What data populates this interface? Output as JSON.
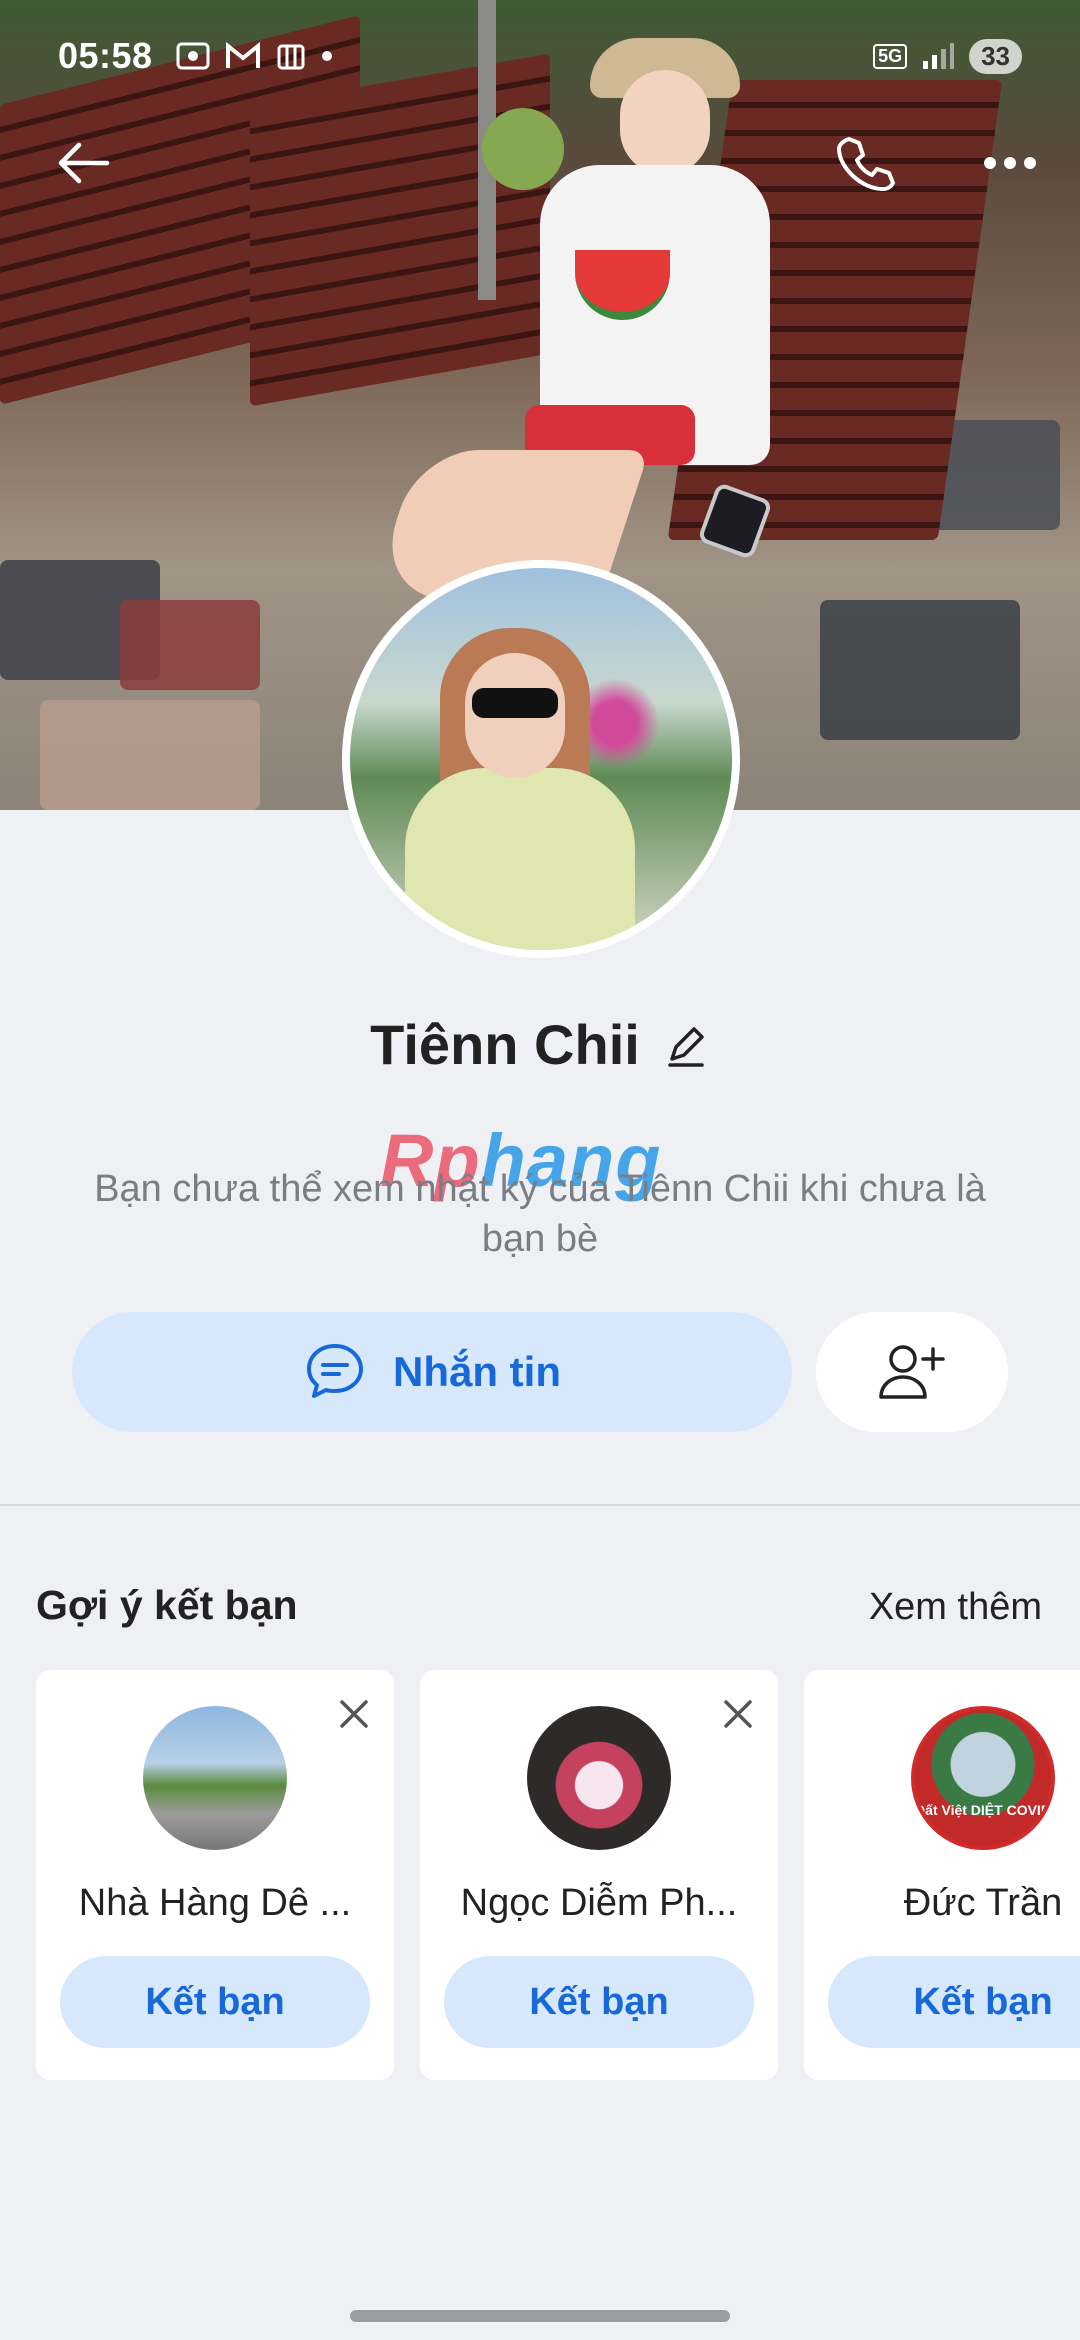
{
  "status_bar": {
    "time": "05:58",
    "network": "5G",
    "battery": "33"
  },
  "profile": {
    "name": "Tiênn Chii",
    "notice": "Bạn chưa thể xem nhật ký của Tiênn Chii khi chưa là bạn bè",
    "watermark_part1": "Rp",
    "watermark_part2": "hang"
  },
  "actions": {
    "message_label": "Nhắn tin"
  },
  "suggestions": {
    "title": "Gợi ý kết bạn",
    "see_more": "Xem thêm",
    "items": [
      {
        "name": "Nhà Hàng Dê ...",
        "button": "Kết bạn"
      },
      {
        "name": "Ngọc Diễm Ph...",
        "button": "Kết bạn"
      },
      {
        "name": "Đức Trần",
        "button": "Kết bạn",
        "avatar_text": "Đất Việt DIỆT COVID"
      }
    ]
  },
  "colors": {
    "accent": "#1769d9",
    "accent_light": "#d7e8fd",
    "background": "#eff0f4"
  }
}
